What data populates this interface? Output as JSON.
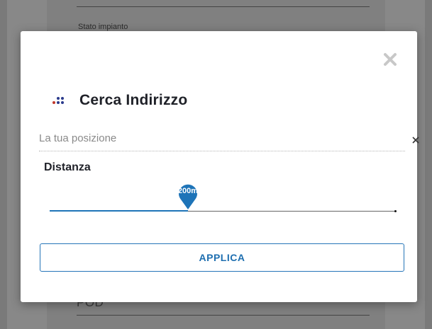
{
  "background": {
    "field_top_label": "Stato impianto",
    "field_bottom_label": "POD"
  },
  "modal": {
    "title": "Cerca Indirizzo",
    "close_icon": "close-icon",
    "logo_icon": "dots-logo-icon",
    "search": {
      "placeholder": "La tua posizione",
      "value": "",
      "clear_icon": "clear-icon"
    },
    "distance": {
      "label": "Distanza",
      "value_label": "200m",
      "fraction": 0.4
    },
    "apply_label": "APPLICA"
  },
  "colors": {
    "accent": "#1e74b8",
    "close_icon": "#c8c8c8",
    "logo_blue": "#2a3a8c",
    "logo_red": "#c0392b"
  }
}
